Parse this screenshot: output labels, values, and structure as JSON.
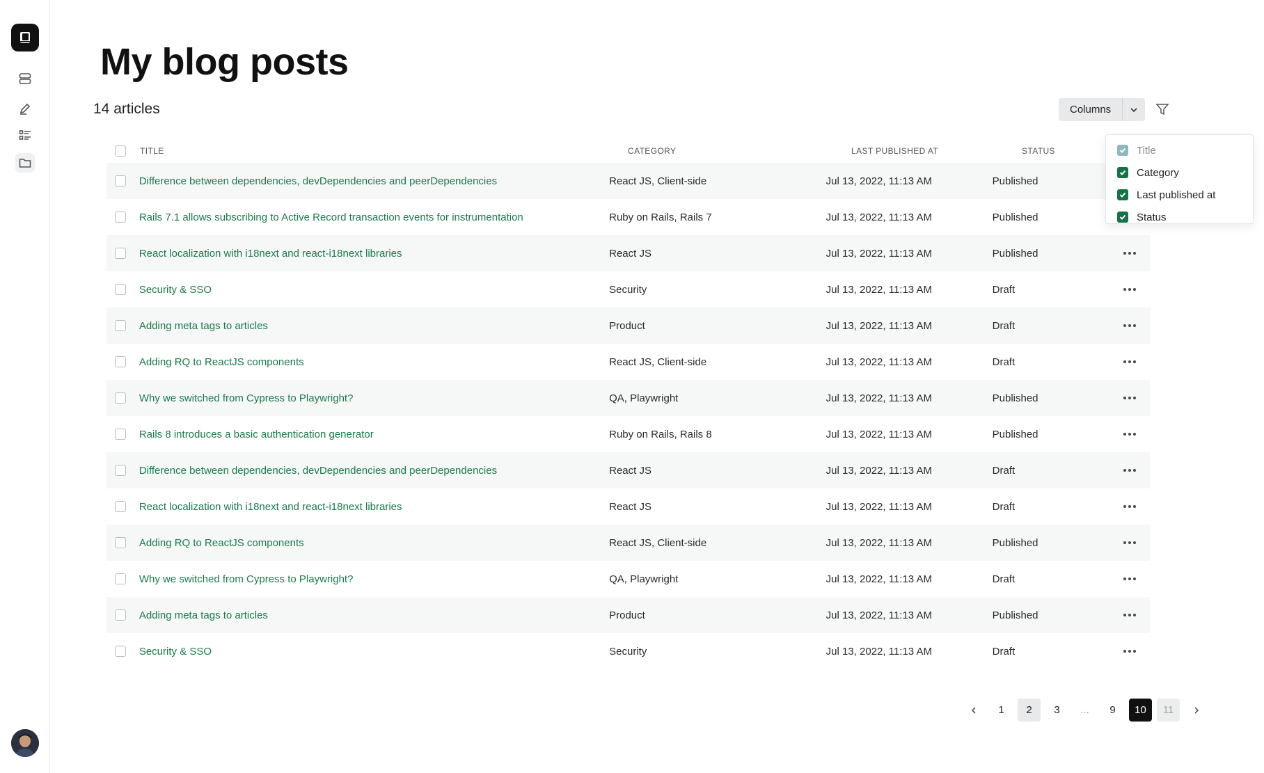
{
  "sidebar": {
    "items": [
      {
        "icon": "database-icon"
      },
      {
        "icon": "pencil-icon"
      },
      {
        "icon": "list-icon"
      },
      {
        "icon": "folder-icon"
      }
    ]
  },
  "header": {
    "title": "My blog posts",
    "count": "14 articles",
    "columns_label": "Columns"
  },
  "table": {
    "columns": [
      "Title",
      "Category",
      "Last published at",
      "Status"
    ],
    "rows": [
      {
        "title": "Difference between dependencies, devDependencies and peerDependencies",
        "category": "React JS, Client-side",
        "date": "Jul 13, 2022, 11:13 AM",
        "status": "Published"
      },
      {
        "title": "Rails 7.1 allows subscribing to Active Record transaction events for instrumentation",
        "category": "Ruby on Rails,  Rails 7",
        "date": "Jul 13, 2022, 11:13 AM",
        "status": "Published"
      },
      {
        "title": "React localization with i18next and react-i18next libraries",
        "category": "React JS",
        "date": "Jul 13, 2022, 11:13 AM",
        "status": "Published"
      },
      {
        "title": "Security & SSO",
        "category": "Security",
        "date": "Jul 13, 2022, 11:13 AM",
        "status": "Draft"
      },
      {
        "title": "Adding meta tags to articles",
        "category": "Product",
        "date": "Jul 13, 2022, 11:13 AM",
        "status": "Draft"
      },
      {
        "title": "Adding RQ to ReactJS components",
        "category": "React JS, Client-side",
        "date": "Jul 13, 2022, 11:13 AM",
        "status": "Draft"
      },
      {
        "title": "Why we switched from Cypress to Playwright?",
        "category": "QA, Playwright",
        "date": "Jul 13, 2022, 11:13 AM",
        "status": "Published"
      },
      {
        "title": "Rails 8 introduces a basic authentication generator",
        "category": "Ruby on Rails,  Rails 8",
        "date": "Jul 13, 2022, 11:13 AM",
        "status": "Published"
      },
      {
        "title": "Difference between dependencies, devDependencies and peerDependencies",
        "category": "React JS",
        "date": "Jul 13, 2022, 11:13 AM",
        "status": "Draft"
      },
      {
        "title": "React localization with i18next and react-i18next libraries",
        "category": "React JS",
        "date": "Jul 13, 2022, 11:13 AM",
        "status": "Draft"
      },
      {
        "title": "Adding RQ to ReactJS components",
        "category": "React JS, Client-side",
        "date": "Jul 13, 2022, 11:13 AM",
        "status": "Published"
      },
      {
        "title": "Why we switched from Cypress to Playwright?",
        "category": "QA, Playwright",
        "date": "Jul 13, 2022, 11:13 AM",
        "status": "Draft"
      },
      {
        "title": "Adding meta tags to articles",
        "category": "Product",
        "date": "Jul 13, 2022, 11:13 AM",
        "status": "Published"
      },
      {
        "title": "Security & SSO",
        "category": "Security",
        "date": "Jul 13, 2022, 11:13 AM",
        "status": "Draft"
      }
    ]
  },
  "column_menu": {
    "items": [
      {
        "label": "Title",
        "checked": true,
        "disabled": true
      },
      {
        "label": "Category",
        "checked": true,
        "disabled": false
      },
      {
        "label": "Last published at",
        "checked": true,
        "disabled": false
      },
      {
        "label": "Status",
        "checked": true,
        "disabled": false
      }
    ]
  },
  "pagination": {
    "pages": [
      "1",
      "2",
      "3",
      "...",
      "9",
      "10",
      "11"
    ],
    "selected": "2",
    "current": "10",
    "disabled": "11"
  },
  "colors": {
    "accent": "#1a7a4c",
    "check": "#157347",
    "row_alt": "#f6f7f7"
  }
}
